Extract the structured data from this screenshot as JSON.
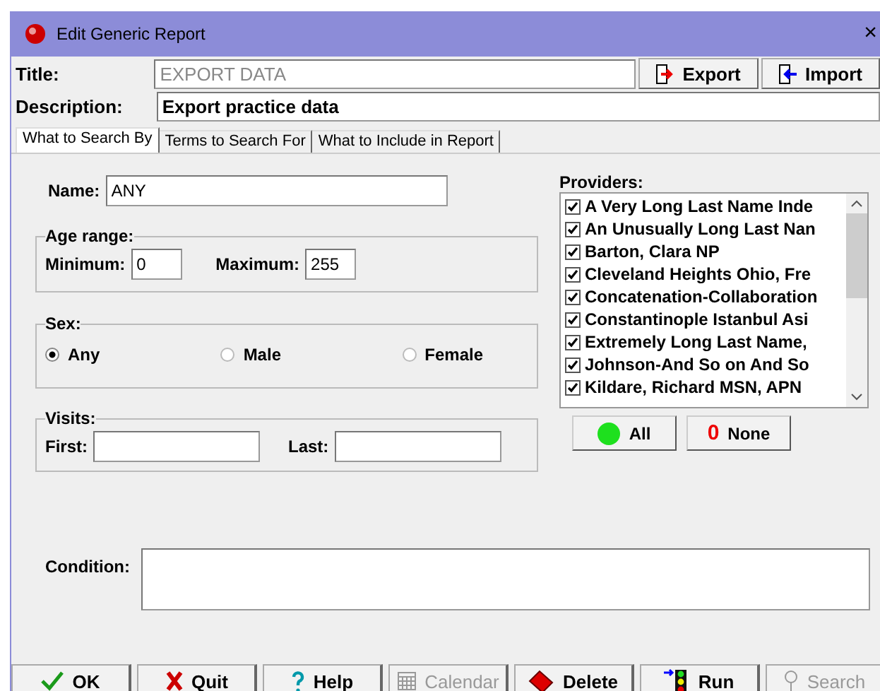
{
  "window": {
    "title": "Edit Generic Report",
    "close": "×"
  },
  "header": {
    "title_label": "Title:",
    "title_value": "EXPORT DATA",
    "title_disabled": true,
    "description_label": "Description:",
    "description_value": "Export practice data",
    "buttons": [
      {
        "label": "Export",
        "kind": "export"
      },
      {
        "label": "Import",
        "kind": "import"
      }
    ]
  },
  "tabs": [
    {
      "label": "What to Search By",
      "selected": true
    },
    {
      "label": "Terms to Search For",
      "selected": false
    },
    {
      "label": "What to Include in Report",
      "selected": false
    }
  ],
  "name": {
    "label": "Name:",
    "value": "ANY"
  },
  "age_range": {
    "legend": "Age range:",
    "minimum_label": "Minimum:",
    "minimum": "0",
    "maximum_label": "Maximum:",
    "maximum": "255"
  },
  "sex": {
    "legend": "Sex:",
    "options": [
      {
        "label": "Any",
        "selected": true
      },
      {
        "label": "Male",
        "selected": false
      },
      {
        "label": "Female",
        "selected": false
      }
    ]
  },
  "visits": {
    "legend": "Visits:",
    "first_label": "First:",
    "last_label": "Last:"
  },
  "providers": {
    "label": "Providers:",
    "items": [
      {
        "name": "A Very Long Last Name Inde",
        "checked": true
      },
      {
        "name": "An Unusually Long Last Nan",
        "checked": true
      },
      {
        "name": "Barton, Clara NP",
        "checked": true
      },
      {
        "name": "Cleveland Heights Ohio, Fre",
        "checked": true
      },
      {
        "name": "Concatenation-Collaboration",
        "checked": true
      },
      {
        "name": "Constantinople Istanbul Asi",
        "checked": true
      },
      {
        "name": "Extremely Long Last Name,",
        "checked": true
      },
      {
        "name": "Johnson-And So on And So",
        "checked": true
      },
      {
        "name": "Kildare, Richard MSN, APN",
        "checked": true
      }
    ],
    "all_label": "All",
    "none_icon": "0",
    "none_label": "None"
  },
  "condition": {
    "label": "Condition:"
  },
  "footer_buttons": [
    {
      "label": "OK",
      "kind": "ok",
      "disabled": false
    },
    {
      "label": "Quit",
      "kind": "quit",
      "disabled": false
    },
    {
      "label": "Help",
      "kind": "help",
      "disabled": false
    },
    {
      "label": "Calendar",
      "kind": "calendar",
      "disabled": true
    },
    {
      "label": "Delete",
      "kind": "delete",
      "disabled": false
    },
    {
      "label": "Run",
      "kind": "run",
      "disabled": false
    },
    {
      "label": "Search",
      "kind": "search",
      "disabled": true
    }
  ]
}
